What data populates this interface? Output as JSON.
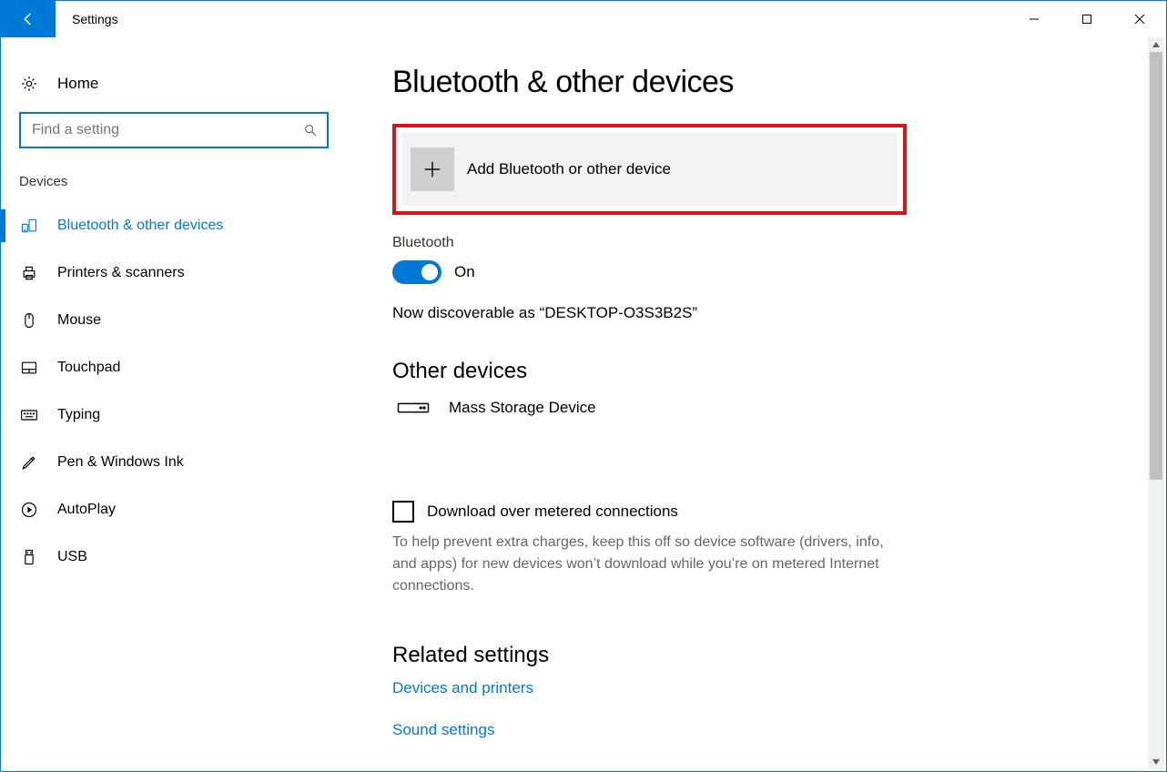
{
  "window": {
    "title": "Settings"
  },
  "sidebar": {
    "home_label": "Home",
    "search_placeholder": "Find a setting",
    "section_label": "Devices",
    "items": [
      {
        "id": "bluetooth",
        "label": "Bluetooth & other devices",
        "active": true
      },
      {
        "id": "printers",
        "label": "Printers & scanners"
      },
      {
        "id": "mouse",
        "label": "Mouse"
      },
      {
        "id": "touchpad",
        "label": "Touchpad"
      },
      {
        "id": "typing",
        "label": "Typing"
      },
      {
        "id": "pen",
        "label": "Pen & Windows Ink"
      },
      {
        "id": "autoplay",
        "label": "AutoPlay"
      },
      {
        "id": "usb",
        "label": "USB"
      }
    ]
  },
  "main": {
    "title": "Bluetooth & other devices",
    "add_device_label": "Add Bluetooth or other device",
    "bluetooth_heading": "Bluetooth",
    "toggle_state_label": "On",
    "discoverable_text": "Now discoverable as “DESKTOP-O3S3B2S”",
    "other_devices_heading": "Other devices",
    "other_devices": [
      {
        "name": "Mass Storage Device"
      }
    ],
    "metered_checkbox_label": "Download over metered connections",
    "metered_help_text": "To help prevent extra charges, keep this off so device software (drivers, info, and apps) for new devices won’t download while you’re on metered Internet connections.",
    "related_heading": "Related settings",
    "related_links": [
      {
        "label": "Devices and printers"
      },
      {
        "label": "Sound settings"
      }
    ]
  }
}
